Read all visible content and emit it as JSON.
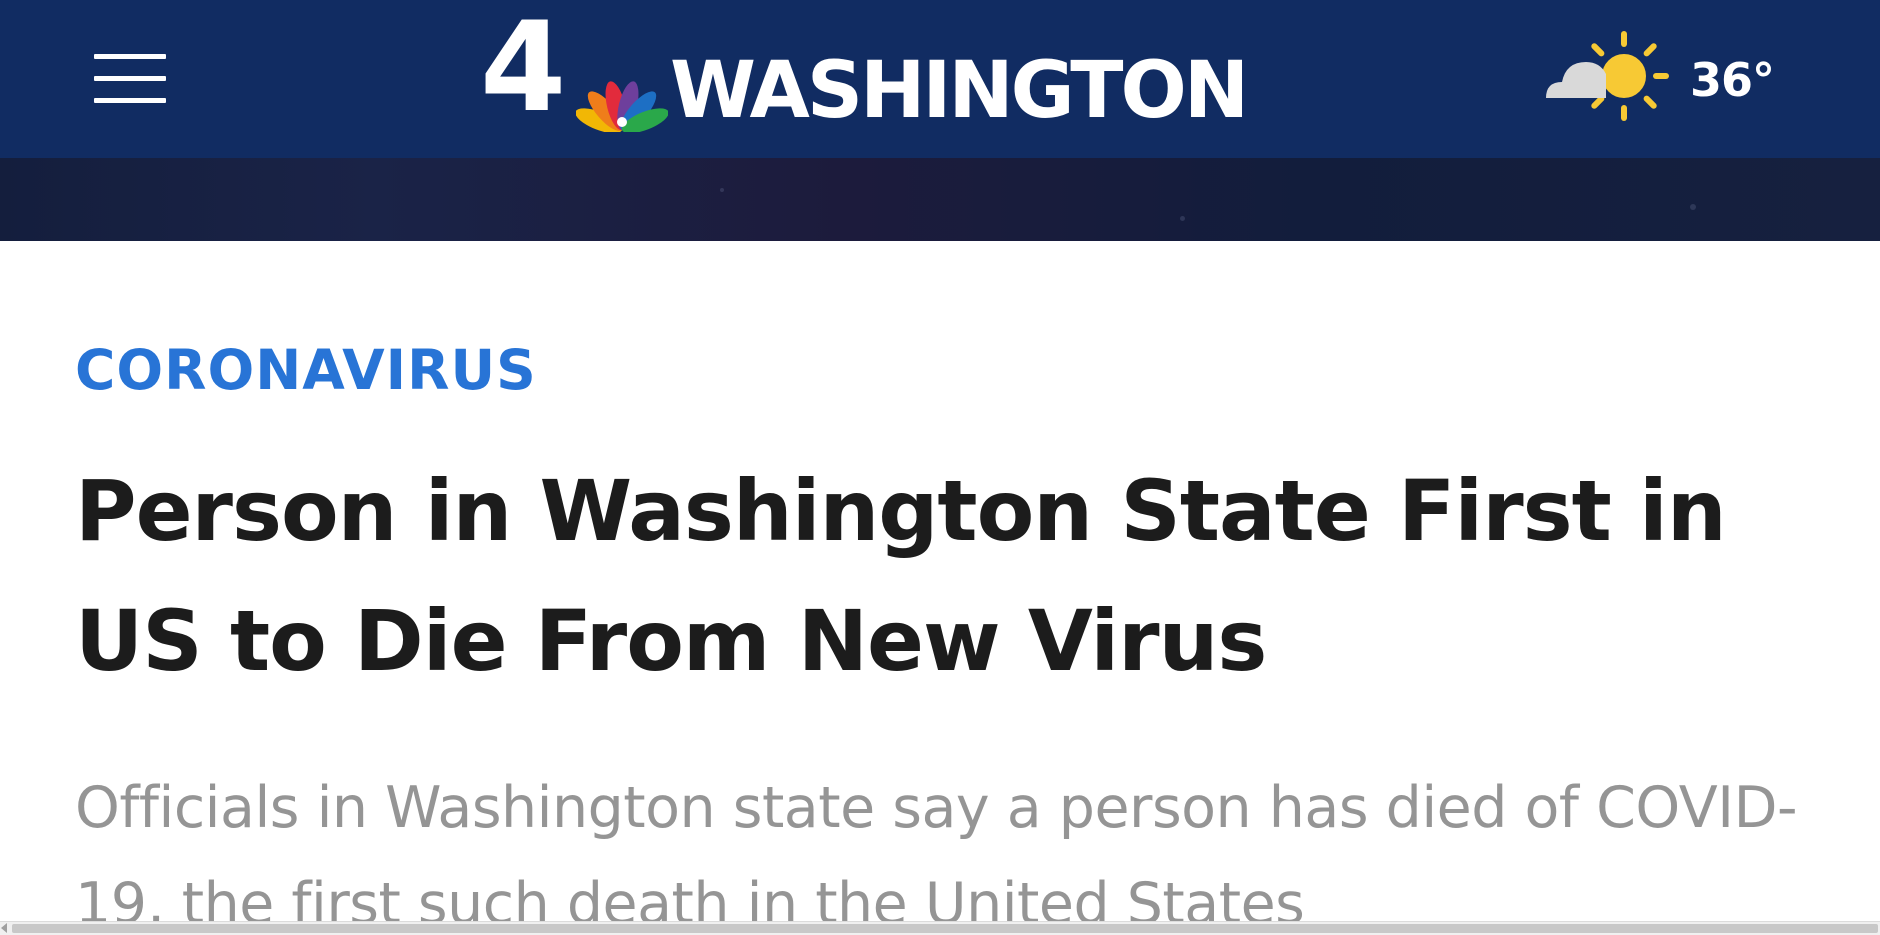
{
  "header": {
    "menu_icon": "hamburger-menu-icon",
    "logo": {
      "channel_number": "4",
      "station_name": "WASHINGTON",
      "brand_icon": "nbc-peacock-icon"
    },
    "weather": {
      "icon": "partly-sunny-icon",
      "temperature": "36°"
    }
  },
  "article": {
    "category": "CORONAVIRUS",
    "headline": "Person in Washington State First in US to Die From New Virus",
    "summary": "Officials in Washington state say a person has died of COVID-19, the first such death in the United States"
  },
  "colors": {
    "header_background": "#112c62",
    "category_blue": "#2874d6",
    "headline_text": "#1c1c1c",
    "summary_text": "#959595",
    "peacock": [
      "#f2b705",
      "#ef7d1a",
      "#e22b3c",
      "#6e3f9c",
      "#1d6fc4",
      "#2aa84a"
    ],
    "sun": "#f7c934",
    "cloud": "#d9d9d9"
  }
}
